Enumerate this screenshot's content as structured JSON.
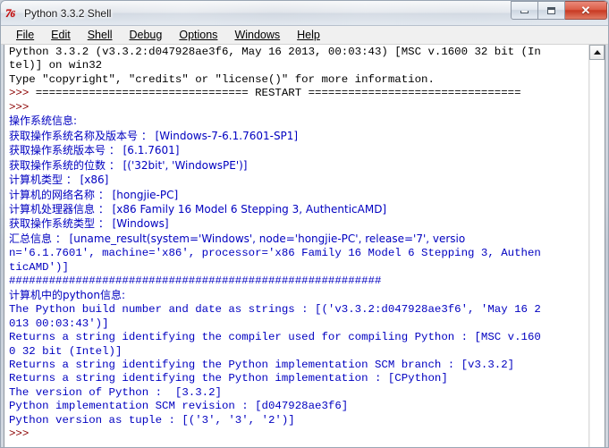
{
  "window": {
    "title": "Python 3.3.2 Shell",
    "icon": "python-logo-icon",
    "controls": {
      "minimize": "minimize-button",
      "maximize": "maximize-button",
      "close_label": "✕"
    }
  },
  "menubar": {
    "items": [
      {
        "label": "File",
        "accel": "F"
      },
      {
        "label": "Edit",
        "accel": "E"
      },
      {
        "label": "Shell",
        "accel": "l"
      },
      {
        "label": "Debug",
        "accel": "D"
      },
      {
        "label": "Options",
        "accel": "O"
      },
      {
        "label": "Windows",
        "accel": "W"
      },
      {
        "label": "Help",
        "accel": "H"
      }
    ]
  },
  "colors": {
    "stdout_blue": "#0000c0",
    "prompt_red": "#8b0000",
    "banner_black": "#000000",
    "title_accent": "#c00000",
    "close_button": "#c83a23"
  },
  "scrollbar": {
    "up_arrow": "scroll-up-arrow-icon",
    "position": "top"
  },
  "console": {
    "lines": [
      {
        "color": "black",
        "text": "Python 3.3.2 (v3.3.2:d047928ae3f6, May 16 2013, 00:03:43) [MSC v.1600 32 bit (In"
      },
      {
        "color": "black",
        "text": "tel)] on win32"
      },
      {
        "color": "black",
        "text": "Type \"copyright\", \"credits\" or \"license()\" for more information."
      },
      {
        "color": "prompt-restart",
        "prompt": ">>> ",
        "text": "================================ RESTART ================================"
      },
      {
        "color": "prompt",
        "prompt": ">>> ",
        "text": ""
      },
      {
        "color": "blue",
        "text": "操作系统信息:"
      },
      {
        "color": "blue",
        "text": "获取操作系统名称及版本号 ： [Windows-7-6.1.7601-SP1]"
      },
      {
        "color": "blue",
        "text": "获取操作系统版本号 ： [6.1.7601]"
      },
      {
        "color": "blue",
        "text": "获取操作系统的位数 ： [('32bit', 'WindowsPE')]"
      },
      {
        "color": "blue",
        "text": "计算机类型 ： [x86]"
      },
      {
        "color": "blue",
        "text": "计算机的网络名称 ： [hongjie-PC]"
      },
      {
        "color": "blue",
        "text": "计算机处理器信息 ： [x86 Family 16 Model 6 Stepping 3, AuthenticAMD]"
      },
      {
        "color": "blue",
        "text": "获取操作系统类型 ： [Windows]"
      },
      {
        "color": "blue",
        "text": "汇总信息 ： [uname_result(system='Windows', node='hongjie-PC', release='7', versio"
      },
      {
        "color": "blue",
        "text": "n='6.1.7601', machine='x86', processor='x86 Family 16 Model 6 Stepping 3, Authen"
      },
      {
        "color": "blue",
        "text": "ticAMD')]"
      },
      {
        "color": "blue",
        "text": "########################################################"
      },
      {
        "color": "blue",
        "text": "计算机中的python信息:"
      },
      {
        "color": "blue",
        "text": "The Python build number and date as strings : [('v3.3.2:d047928ae3f6', 'May 16 2"
      },
      {
        "color": "blue",
        "text": "013 00:03:43')]"
      },
      {
        "color": "blue",
        "text": "Returns a string identifying the compiler used for compiling Python : [MSC v.160"
      },
      {
        "color": "blue",
        "text": "0 32 bit (Intel)]"
      },
      {
        "color": "blue",
        "text": "Returns a string identifying the Python implementation SCM branch : [v3.3.2]"
      },
      {
        "color": "blue",
        "text": "Returns a string identifying the Python implementation : [CPython]"
      },
      {
        "color": "blue",
        "text": "The version of Python :  [3.3.2]"
      },
      {
        "color": "blue",
        "text": "Python implementation SCM revision : [d047928ae3f6]"
      },
      {
        "color": "blue",
        "text": "Python version as tuple : [('3', '3', '2')]"
      },
      {
        "color": "prompt",
        "prompt": ">>> ",
        "text": ""
      }
    ]
  }
}
